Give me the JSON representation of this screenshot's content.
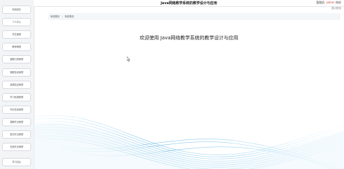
{
  "header": {
    "title": "Java网络教学系统的教学设计与应用",
    "user_prefix": "管理员",
    "username": "admin",
    "user_suffix": "你好",
    "exit": "退出登录"
  },
  "breadcrumb": {
    "home": "系统首页",
    "current": "系统首页"
  },
  "welcome": "欢迎使用 Java网络教学系统的教学设计与应用",
  "sidebar": {
    "items": [
      {
        "label": "系统首页"
      },
      {
        "label": "个人中心"
      },
      {
        "label": "学生管理"
      },
      {
        "label": "教师管理"
      },
      {
        "label": "课程分类管理"
      },
      {
        "label": "课程信息管理"
      },
      {
        "label": "选课信息管理"
      },
      {
        "label": "学习资源管理"
      },
      {
        "label": "作业信息管理"
      },
      {
        "label": "课程作业管理"
      },
      {
        "label": "提交作业管理"
      },
      {
        "label": "在线作业管理"
      },
      {
        "label": "学习论坛"
      }
    ]
  },
  "colors": {
    "wave": "#5ab4e6",
    "accent_user": "#d04040"
  }
}
